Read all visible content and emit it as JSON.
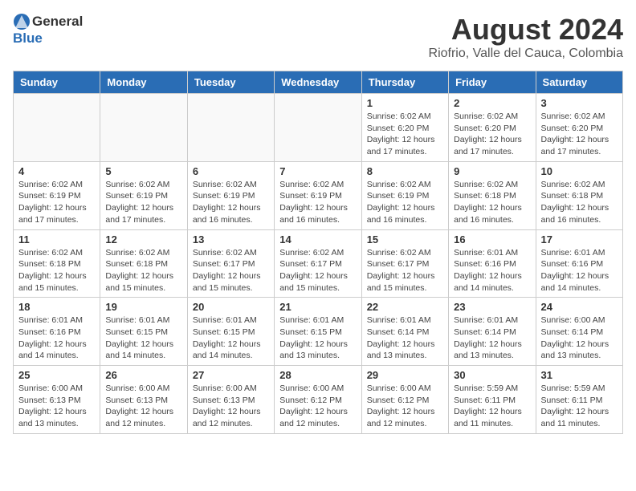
{
  "header": {
    "logo_general": "General",
    "logo_blue": "Blue",
    "month_year": "August 2024",
    "location": "Riofrio, Valle del Cauca, Colombia"
  },
  "calendar": {
    "days_of_week": [
      "Sunday",
      "Monday",
      "Tuesday",
      "Wednesday",
      "Thursday",
      "Friday",
      "Saturday"
    ],
    "weeks": [
      [
        {
          "day": "",
          "info": ""
        },
        {
          "day": "",
          "info": ""
        },
        {
          "day": "",
          "info": ""
        },
        {
          "day": "",
          "info": ""
        },
        {
          "day": "1",
          "info": "Sunrise: 6:02 AM\nSunset: 6:20 PM\nDaylight: 12 hours\nand 17 minutes."
        },
        {
          "day": "2",
          "info": "Sunrise: 6:02 AM\nSunset: 6:20 PM\nDaylight: 12 hours\nand 17 minutes."
        },
        {
          "day": "3",
          "info": "Sunrise: 6:02 AM\nSunset: 6:20 PM\nDaylight: 12 hours\nand 17 minutes."
        }
      ],
      [
        {
          "day": "4",
          "info": "Sunrise: 6:02 AM\nSunset: 6:19 PM\nDaylight: 12 hours\nand 17 minutes."
        },
        {
          "day": "5",
          "info": "Sunrise: 6:02 AM\nSunset: 6:19 PM\nDaylight: 12 hours\nand 17 minutes."
        },
        {
          "day": "6",
          "info": "Sunrise: 6:02 AM\nSunset: 6:19 PM\nDaylight: 12 hours\nand 16 minutes."
        },
        {
          "day": "7",
          "info": "Sunrise: 6:02 AM\nSunset: 6:19 PM\nDaylight: 12 hours\nand 16 minutes."
        },
        {
          "day": "8",
          "info": "Sunrise: 6:02 AM\nSunset: 6:19 PM\nDaylight: 12 hours\nand 16 minutes."
        },
        {
          "day": "9",
          "info": "Sunrise: 6:02 AM\nSunset: 6:18 PM\nDaylight: 12 hours\nand 16 minutes."
        },
        {
          "day": "10",
          "info": "Sunrise: 6:02 AM\nSunset: 6:18 PM\nDaylight: 12 hours\nand 16 minutes."
        }
      ],
      [
        {
          "day": "11",
          "info": "Sunrise: 6:02 AM\nSunset: 6:18 PM\nDaylight: 12 hours\nand 15 minutes."
        },
        {
          "day": "12",
          "info": "Sunrise: 6:02 AM\nSunset: 6:18 PM\nDaylight: 12 hours\nand 15 minutes."
        },
        {
          "day": "13",
          "info": "Sunrise: 6:02 AM\nSunset: 6:17 PM\nDaylight: 12 hours\nand 15 minutes."
        },
        {
          "day": "14",
          "info": "Sunrise: 6:02 AM\nSunset: 6:17 PM\nDaylight: 12 hours\nand 15 minutes."
        },
        {
          "day": "15",
          "info": "Sunrise: 6:02 AM\nSunset: 6:17 PM\nDaylight: 12 hours\nand 15 minutes."
        },
        {
          "day": "16",
          "info": "Sunrise: 6:01 AM\nSunset: 6:16 PM\nDaylight: 12 hours\nand 14 minutes."
        },
        {
          "day": "17",
          "info": "Sunrise: 6:01 AM\nSunset: 6:16 PM\nDaylight: 12 hours\nand 14 minutes."
        }
      ],
      [
        {
          "day": "18",
          "info": "Sunrise: 6:01 AM\nSunset: 6:16 PM\nDaylight: 12 hours\nand 14 minutes."
        },
        {
          "day": "19",
          "info": "Sunrise: 6:01 AM\nSunset: 6:15 PM\nDaylight: 12 hours\nand 14 minutes."
        },
        {
          "day": "20",
          "info": "Sunrise: 6:01 AM\nSunset: 6:15 PM\nDaylight: 12 hours\nand 14 minutes."
        },
        {
          "day": "21",
          "info": "Sunrise: 6:01 AM\nSunset: 6:15 PM\nDaylight: 12 hours\nand 13 minutes."
        },
        {
          "day": "22",
          "info": "Sunrise: 6:01 AM\nSunset: 6:14 PM\nDaylight: 12 hours\nand 13 minutes."
        },
        {
          "day": "23",
          "info": "Sunrise: 6:01 AM\nSunset: 6:14 PM\nDaylight: 12 hours\nand 13 minutes."
        },
        {
          "day": "24",
          "info": "Sunrise: 6:00 AM\nSunset: 6:14 PM\nDaylight: 12 hours\nand 13 minutes."
        }
      ],
      [
        {
          "day": "25",
          "info": "Sunrise: 6:00 AM\nSunset: 6:13 PM\nDaylight: 12 hours\nand 13 minutes."
        },
        {
          "day": "26",
          "info": "Sunrise: 6:00 AM\nSunset: 6:13 PM\nDaylight: 12 hours\nand 12 minutes."
        },
        {
          "day": "27",
          "info": "Sunrise: 6:00 AM\nSunset: 6:13 PM\nDaylight: 12 hours\nand 12 minutes."
        },
        {
          "day": "28",
          "info": "Sunrise: 6:00 AM\nSunset: 6:12 PM\nDaylight: 12 hours\nand 12 minutes."
        },
        {
          "day": "29",
          "info": "Sunrise: 6:00 AM\nSunset: 6:12 PM\nDaylight: 12 hours\nand 12 minutes."
        },
        {
          "day": "30",
          "info": "Sunrise: 5:59 AM\nSunset: 6:11 PM\nDaylight: 12 hours\nand 11 minutes."
        },
        {
          "day": "31",
          "info": "Sunrise: 5:59 AM\nSunset: 6:11 PM\nDaylight: 12 hours\nand 11 minutes."
        }
      ]
    ]
  }
}
